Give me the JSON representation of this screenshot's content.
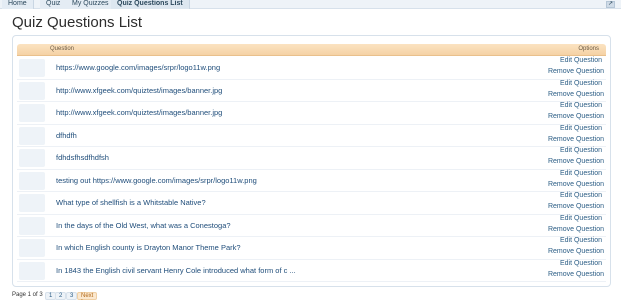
{
  "breadcrumb": {
    "items": [
      "Home",
      "Quiz",
      "My Quizzes",
      "Quiz Questions List"
    ]
  },
  "page": {
    "title": "Quiz Questions List"
  },
  "table": {
    "header_question": "Question",
    "header_options": "Options",
    "edit_label": "Edit Question",
    "remove_label": "Remove Question",
    "rows": [
      "https://www.google.com/images/srpr/logo11w.png",
      "http://www.xfgeek.com/quiztest/images/banner.jpg",
      "http://www.xfgeek.com/quiztest/images/banner.jpg",
      "dfhdfh",
      "fdhdsfhsdfhdfsh",
      "testing out https://www.google.com/images/srpr/logo11w.png",
      "What type of shellfish is a Whitstable Native?",
      "In the days of the Old West, what was a Conestoga?",
      "In which English county is Drayton Manor Theme Park?",
      "In 1843 the English civil servant Henry Cole introduced what form of c ..."
    ]
  },
  "pager": {
    "label": "Page 1 of 3",
    "pages": [
      "1",
      "2",
      "3"
    ],
    "next": "Next >"
  },
  "colors": {
    "header_bg": "#f5d2a5",
    "link": "#1f4d7a",
    "breadcrumb_bg": "#eef3f8"
  }
}
